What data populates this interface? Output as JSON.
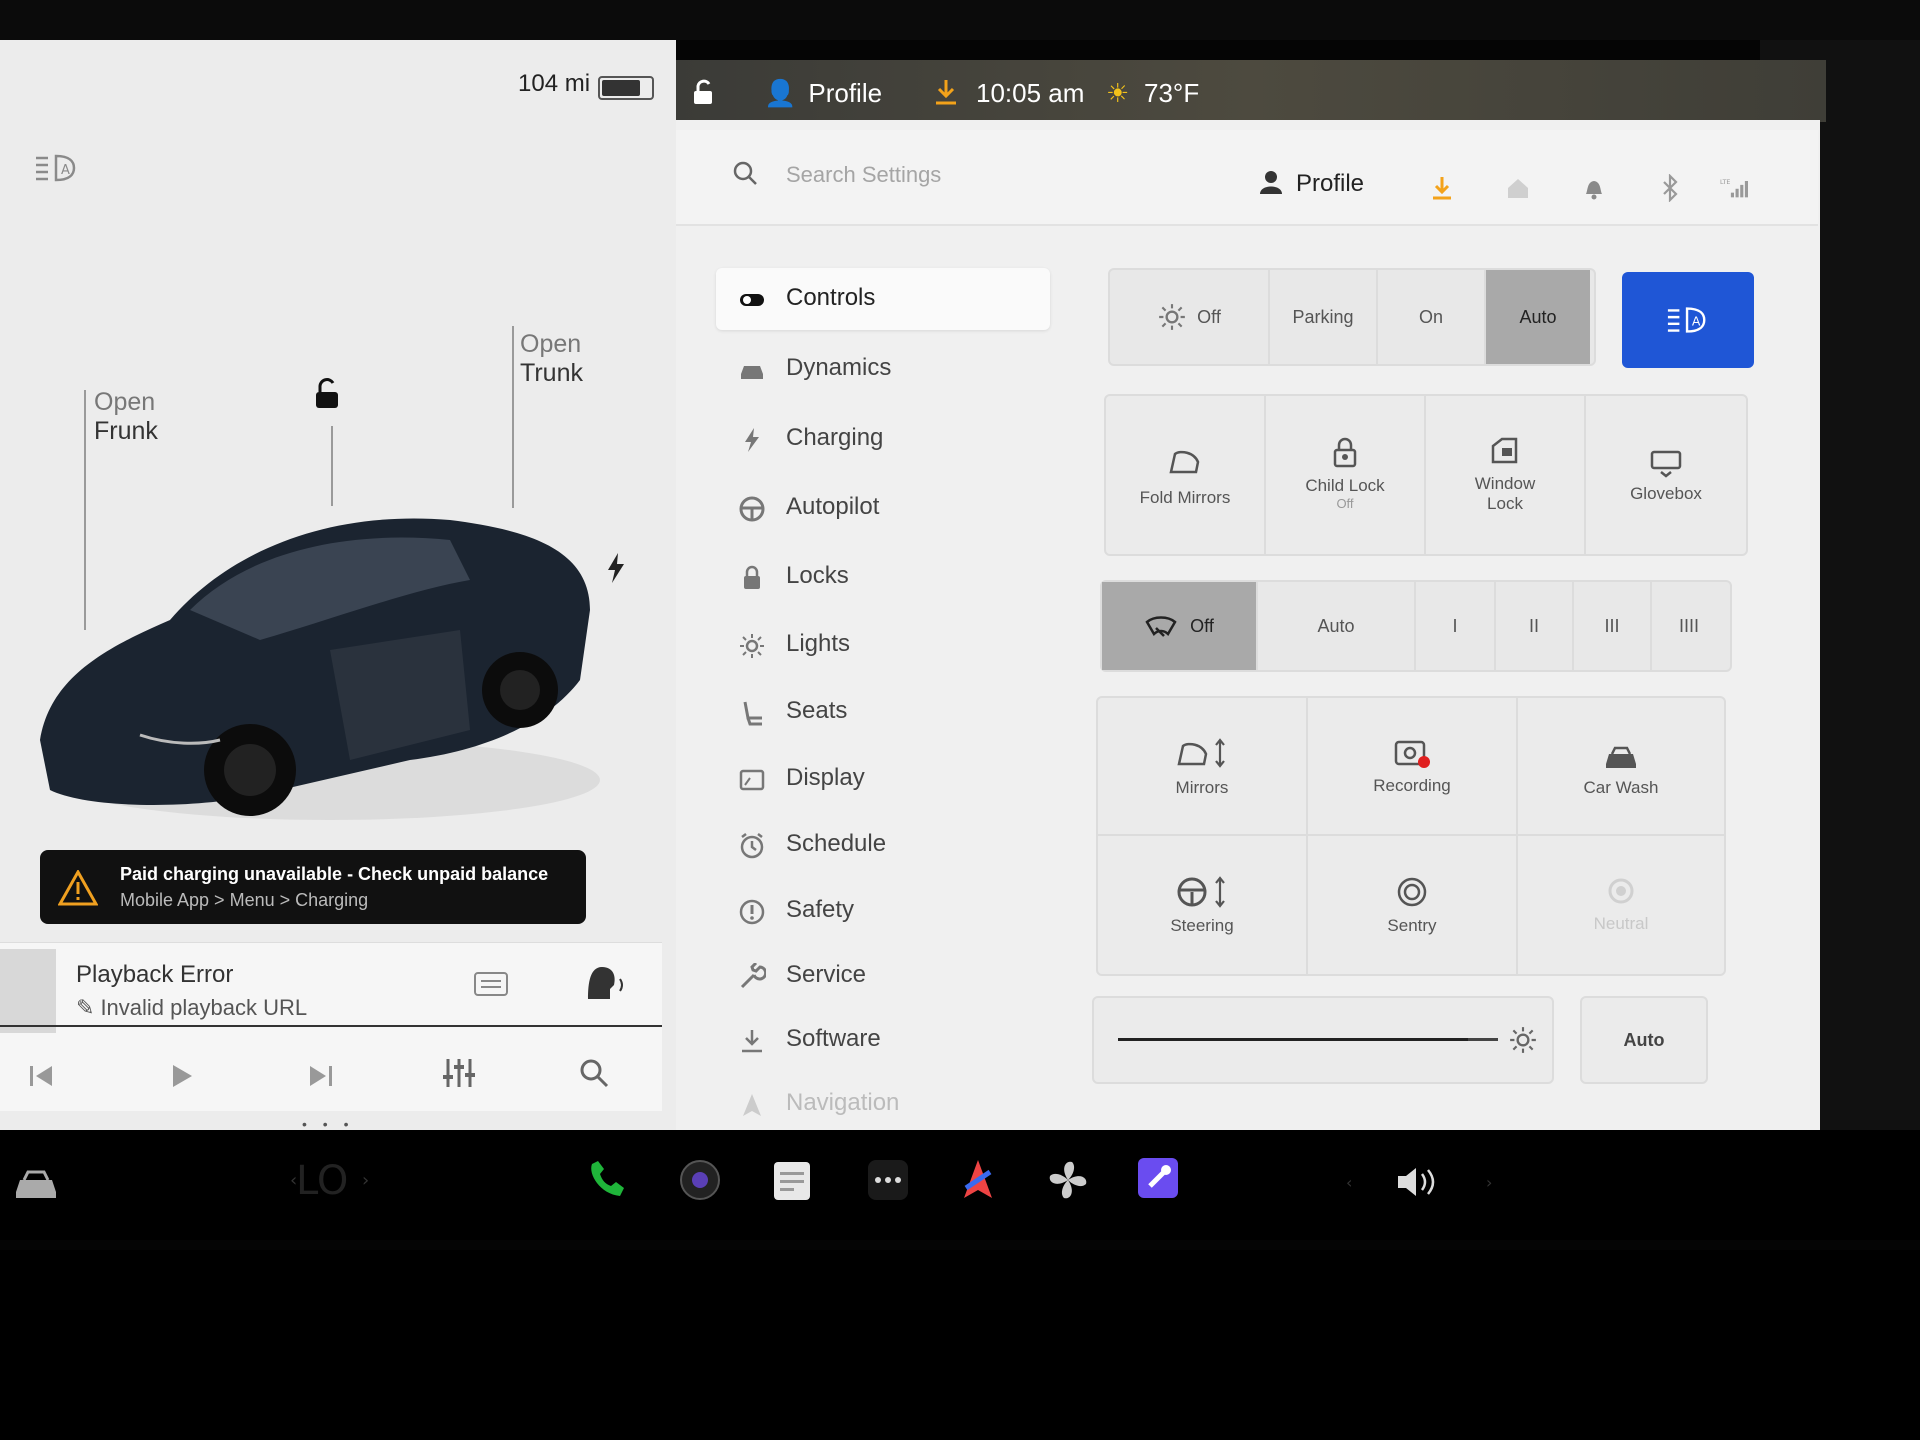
{
  "status": {
    "range": "104 mi",
    "battery_level": 0.8,
    "profile": "Profile",
    "time": "10:05 am",
    "temperature": "73°F"
  },
  "car": {
    "frunk": {
      "line1": "Open",
      "line2": "Frunk"
    },
    "trunk": {
      "line1": "Open",
      "line2": "Trunk"
    }
  },
  "alert": {
    "title": "Paid charging unavailable - Check unpaid balance",
    "subtitle": "Mobile App > Menu > Charging"
  },
  "media": {
    "title": "Playback Error",
    "subtitle": "Invalid playback URL"
  },
  "search": {
    "placeholder": "Search Settings"
  },
  "header": {
    "profile": "Profile"
  },
  "nav": {
    "items": [
      {
        "label": "Controls"
      },
      {
        "label": "Dynamics"
      },
      {
        "label": "Charging"
      },
      {
        "label": "Autopilot"
      },
      {
        "label": "Locks"
      },
      {
        "label": "Lights"
      },
      {
        "label": "Seats"
      },
      {
        "label": "Display"
      },
      {
        "label": "Schedule"
      },
      {
        "label": "Safety"
      },
      {
        "label": "Service"
      },
      {
        "label": "Software"
      },
      {
        "label": "Navigation"
      }
    ]
  },
  "lights": {
    "off": "Off",
    "parking": "Parking",
    "on": "On",
    "auto": "Auto",
    "selected": "Auto"
  },
  "quick": {
    "fold_mirrors": "Fold Mirrors",
    "child_lock": "Child Lock",
    "child_lock_state": "Off",
    "window_lock_1": "Window",
    "window_lock_2": "Lock",
    "glovebox": "Glovebox"
  },
  "wipers": {
    "off": "Off",
    "auto": "Auto",
    "s1": "I",
    "s2": "II",
    "s3": "III",
    "s4": "IIII",
    "selected": "Off"
  },
  "actions": {
    "mirrors": "Mirrors",
    "recording": "Recording",
    "car_wash": "Car Wash",
    "steering": "Steering",
    "sentry": "Sentry",
    "neutral": "Neutral"
  },
  "brightness": {
    "auto": "Auto",
    "level": 0.92
  },
  "colors": {
    "accent_blue": "#1f56d6",
    "charge_green": "#1fb53a",
    "rec_red": "#e02020"
  }
}
